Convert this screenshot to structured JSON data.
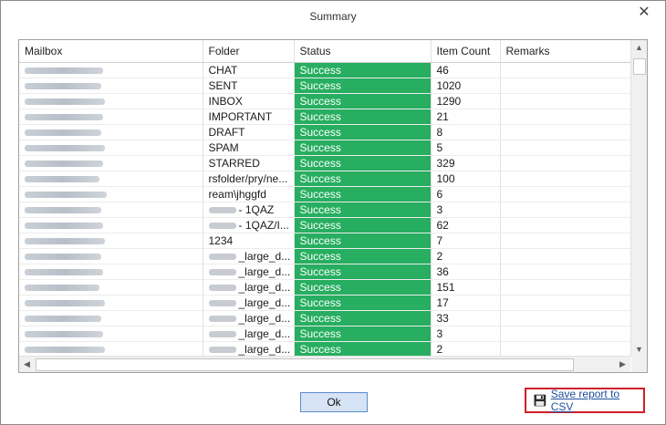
{
  "dialog": {
    "title": "Summary",
    "close_label": "✕"
  },
  "table": {
    "columns": [
      "Mailbox",
      "Folder",
      "Status",
      "Item Count",
      "Remarks"
    ],
    "rows": [
      {
        "folder": "CHAT",
        "status": "Success",
        "count": "46"
      },
      {
        "folder": "SENT",
        "status": "Success",
        "count": "1020"
      },
      {
        "folder": "INBOX",
        "status": "Success",
        "count": "1290"
      },
      {
        "folder": "IMPORTANT",
        "status": "Success",
        "count": "21"
      },
      {
        "folder": "DRAFT",
        "status": "Success",
        "count": "8"
      },
      {
        "folder": "SPAM",
        "status": "Success",
        "count": "5"
      },
      {
        "folder": "STARRED",
        "status": "Success",
        "count": "329"
      },
      {
        "folder": "rsfolder/pry/ne...",
        "status": "Success",
        "count": "100"
      },
      {
        "folder": "ream\\jhggfd",
        "status": "Success",
        "count": "6"
      },
      {
        "folder": "- 1QAZ",
        "status": "Success",
        "count": "3",
        "blur_prefix": true
      },
      {
        "folder": "- 1QAZ/I...",
        "status": "Success",
        "count": "62",
        "blur_prefix": true
      },
      {
        "folder": "1234",
        "status": "Success",
        "count": "7"
      },
      {
        "folder": "_large_d...",
        "status": "Success",
        "count": "2",
        "blur_prefix": true
      },
      {
        "folder": "_large_d...",
        "status": "Success",
        "count": "36",
        "blur_prefix": true
      },
      {
        "folder": "_large_d...",
        "status": "Success",
        "count": "151",
        "blur_prefix": true
      },
      {
        "folder": "_large_d...",
        "status": "Success",
        "count": "17",
        "blur_prefix": true
      },
      {
        "folder": "_large_d...",
        "status": "Success",
        "count": "33",
        "blur_prefix": true
      },
      {
        "folder": "_large_d...",
        "status": "Success",
        "count": "3",
        "blur_prefix": true
      },
      {
        "folder": "_large_d...",
        "status": "Success",
        "count": "2",
        "blur_prefix": true
      }
    ]
  },
  "footer": {
    "ok_label": "Ok",
    "save_label": "Save report to CSV"
  },
  "colors": {
    "success": "#27ae60",
    "highlight_border": "#d01f2a",
    "link": "#1d4f9c"
  },
  "icons": {
    "close": "close-icon",
    "save": "floppy-disk-icon",
    "scroll_up": "arrow-up-icon",
    "scroll_down": "arrow-down-icon",
    "scroll_left": "arrow-left-icon",
    "scroll_right": "arrow-right-icon"
  }
}
